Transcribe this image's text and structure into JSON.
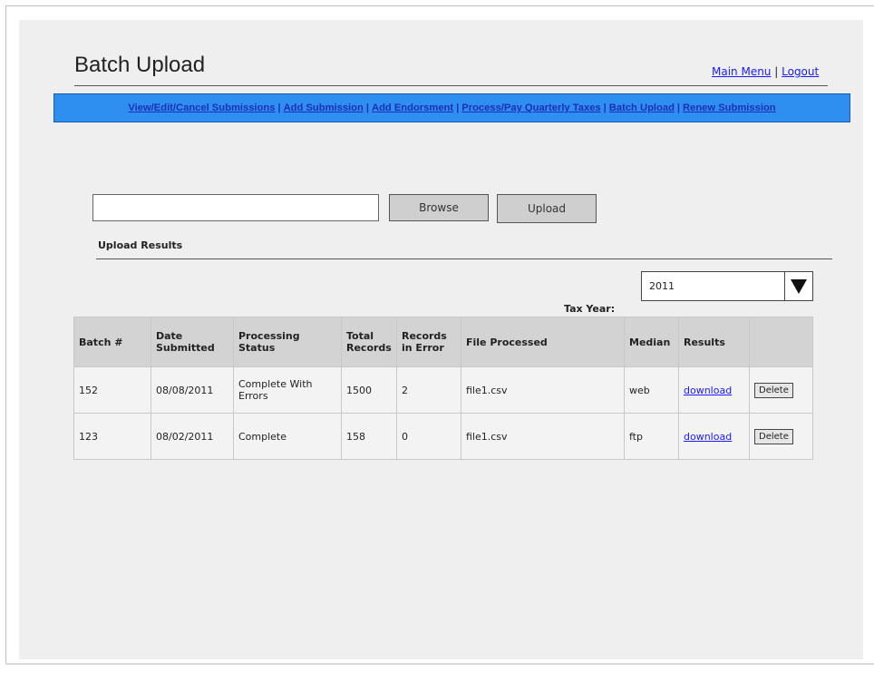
{
  "header": {
    "title": "Batch Upload",
    "main_menu_link": "Main Menu",
    "separator": "|",
    "logout_link": "Logout"
  },
  "nav": {
    "items": [
      "View/Edit/Cancel Submissions",
      "Add Submission",
      "Add Endorsment",
      "Process/Pay Quarterly Taxes",
      "Batch Upload",
      "Renew Submission"
    ],
    "separator": "|",
    "bar_color": "#2f8ff0"
  },
  "upload": {
    "file_value": "",
    "browse_label": "Browse",
    "upload_label": "Upload"
  },
  "results": {
    "section_label": "Upload Results",
    "tax_year_label": "Tax Year:",
    "tax_year_value": "2011",
    "columns": [
      "Batch #",
      "Date Submitted",
      "Processing Status",
      "Total Records",
      "Records in Error",
      "File Processed",
      "Median",
      "Results",
      ""
    ],
    "rows": [
      {
        "batch": "152",
        "date": "08/08/2011",
        "status": "Complete With Errors",
        "total": "1500",
        "errors": "2",
        "file": "file1.csv",
        "median": "web",
        "results_link": "download",
        "delete_label": "Delete"
      },
      {
        "batch": "123",
        "date": "08/02/2011",
        "status": "Complete",
        "total": "158",
        "errors": "0",
        "file": "file1.csv",
        "median": "ftp",
        "results_link": "download",
        "delete_label": "Delete"
      }
    ]
  }
}
